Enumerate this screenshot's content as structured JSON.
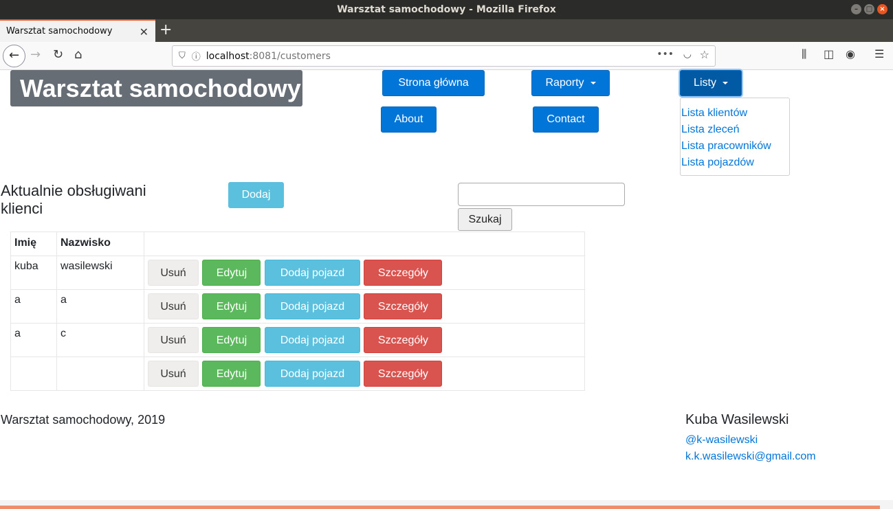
{
  "window": {
    "title": "Warsztat samochodowy - Mozilla Firefox"
  },
  "tab": {
    "title": "Warsztat samochodowy",
    "close": "✕",
    "new": "+"
  },
  "browser": {
    "url_host": "localhost",
    "url_rest": ":8081/customers"
  },
  "brand": "Warsztat samochodowy",
  "nav": {
    "home": "Strona główna",
    "reports": "Raporty",
    "lists": "Listy",
    "about": "About",
    "contact": "Contact"
  },
  "lists_menu": [
    "Lista klientów",
    "Lista zleceń",
    "Lista pracowników",
    "Lista pojazdów"
  ],
  "page": {
    "heading_line1": "Aktualnie obsługiwani",
    "heading_line2": "klienci",
    "add_button": "Dodaj",
    "search_value": "",
    "search_button": "Szukaj"
  },
  "table": {
    "headers": [
      "Imię",
      "Nazwisko",
      ""
    ],
    "rows": [
      {
        "first": "kuba",
        "last": "wasilewski"
      },
      {
        "first": "a",
        "last": "a"
      },
      {
        "first": "a",
        "last": "c"
      },
      {
        "first": "",
        "last": ""
      }
    ],
    "actions": {
      "delete": "Usuń",
      "edit": "Edytuj",
      "add_vehicle": "Dodaj pojazd",
      "details": "Szczegóły"
    }
  },
  "footer": {
    "copyright": "Warsztat samochodowy, 2019",
    "author": "Kuba Wasilewski",
    "github": "@k-wasilewski",
    "email": "k.k.wasilewski@gmail.com"
  },
  "colors": {
    "primary": "#0275d8",
    "info": "#5bc0de",
    "success": "#5cb85c",
    "danger": "#d9534f",
    "brand_bg": "#666d75"
  }
}
